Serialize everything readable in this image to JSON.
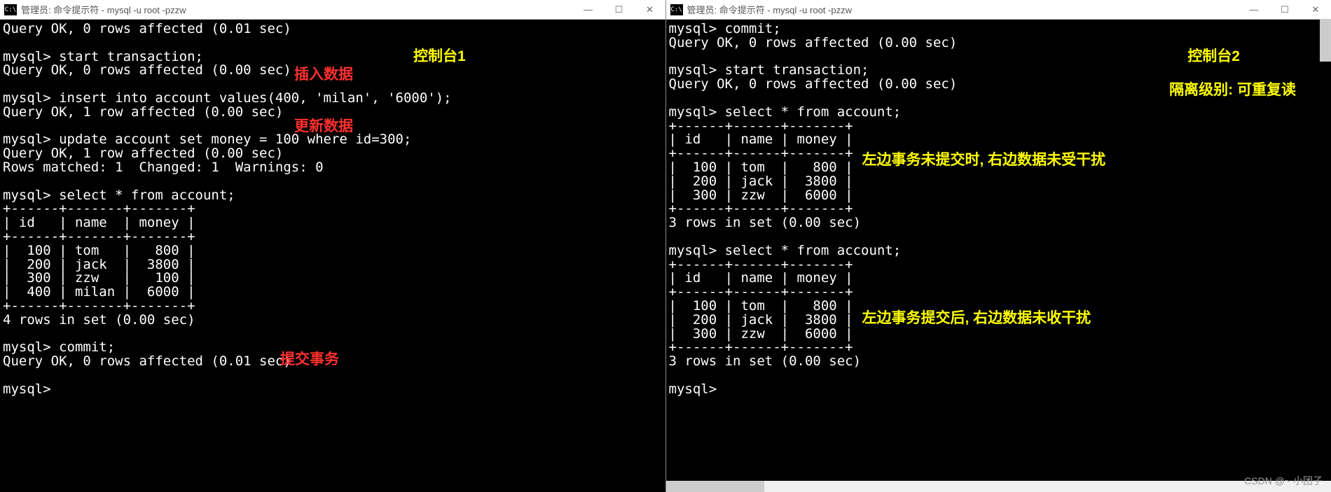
{
  "left": {
    "title": "管理员: 命令提示符 - mysql  -u root -pzzw",
    "icon_label": "C:\\",
    "min": "—",
    "max": "☐",
    "close": "✕",
    "lines": [
      "Query OK, 0 rows affected (0.01 sec)",
      "",
      "mysql> start transaction;",
      "Query OK, 0 rows affected (0.00 sec)",
      "",
      "mysql> insert into account values(400, 'milan', '6000');",
      "Query OK, 1 row affected (0.00 sec)",
      "",
      "mysql> update account set money = 100 where id=300;",
      "Query OK, 1 row affected (0.00 sec)",
      "Rows matched: 1  Changed: 1  Warnings: 0",
      "",
      "mysql> select * from account;",
      "+------+-------+-------+",
      "| id   | name  | money |",
      "+------+-------+-------+",
      "|  100 | tom   |   800 |",
      "|  200 | jack  |  3800 |",
      "|  300 | zzw   |   100 |",
      "|  400 | milan |  6000 |",
      "+------+-------+-------+",
      "4 rows in set (0.00 sec)",
      "",
      "mysql> commit;",
      "Query OK, 0 rows affected (0.01 sec)",
      "",
      "mysql>"
    ],
    "ann_console": "控制台1",
    "ann_insert": "插入数据",
    "ann_update": "更新数据",
    "ann_commit": "提交事务"
  },
  "right": {
    "title": "管理员: 命令提示符 - mysql  -u root -pzzw",
    "icon_label": "C:\\",
    "min": "—",
    "max": "☐",
    "close": "✕",
    "lines": [
      "mysql> commit;",
      "Query OK, 0 rows affected (0.00 sec)",
      "",
      "mysql> start transaction;",
      "Query OK, 0 rows affected (0.00 sec)",
      "",
      "mysql> select * from account;",
      "+------+------+-------+",
      "| id   | name | money |",
      "+------+------+-------+",
      "|  100 | tom  |   800 |",
      "|  200 | jack |  3800 |",
      "|  300 | zzw  |  6000 |",
      "+------+------+-------+",
      "3 rows in set (0.00 sec)",
      "",
      "mysql> select * from account;",
      "+------+------+-------+",
      "| id   | name | money |",
      "+------+------+-------+",
      "|  100 | tom  |   800 |",
      "|  200 | jack |  3800 |",
      "|  300 | zzw  |  6000 |",
      "+------+------+-------+",
      "3 rows in set (0.00 sec)",
      "",
      "mysql>"
    ],
    "ann_console": "控制台2",
    "ann_isolation": "隔离级别: 可重复读",
    "ann_before": "左边事务未提交时, 右边数据未受干扰",
    "ann_after": "左边事务提交后, 右边数据未收干扰"
  },
  "watermark": "CSDN @~ 小团子"
}
